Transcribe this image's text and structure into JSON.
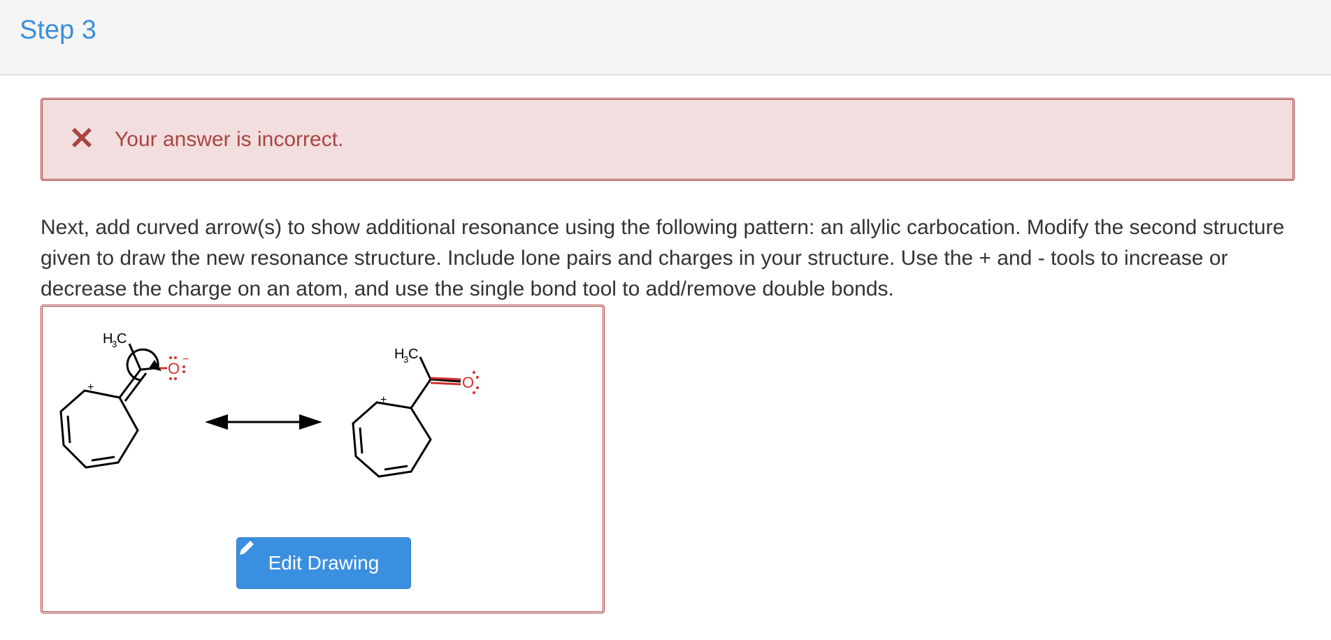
{
  "header": {
    "title": "Step 3"
  },
  "alert": {
    "message": "Your answer is incorrect.",
    "color": "#a94442",
    "background": "#f2dede"
  },
  "instructions": "Next, add curved arrow(s) to show additional resonance using the following pattern: an allylic carbocation. Modify the second structure given to draw the new resonance structure. Include lone pairs and charges in your structure. Use the + and - tools to increase or decrease the charge on an atom, and use the single bond tool to add/remove double bonds.",
  "drawing": {
    "structure1": {
      "methyl_label": "H",
      "methyl_sub": "3",
      "methyl_c": "C",
      "oxygen": "O",
      "oxygen_charge": "−",
      "carbon_charge": "+"
    },
    "structure2": {
      "methyl_label": "H",
      "methyl_sub": "3",
      "methyl_c": "C",
      "oxygen": "O",
      "carbon_charge": "+"
    },
    "edit_button_label": "Edit Drawing"
  },
  "colors": {
    "accent": "#3a8fd9",
    "button": "#3b8fe0",
    "oxygen": "#d0312d"
  }
}
